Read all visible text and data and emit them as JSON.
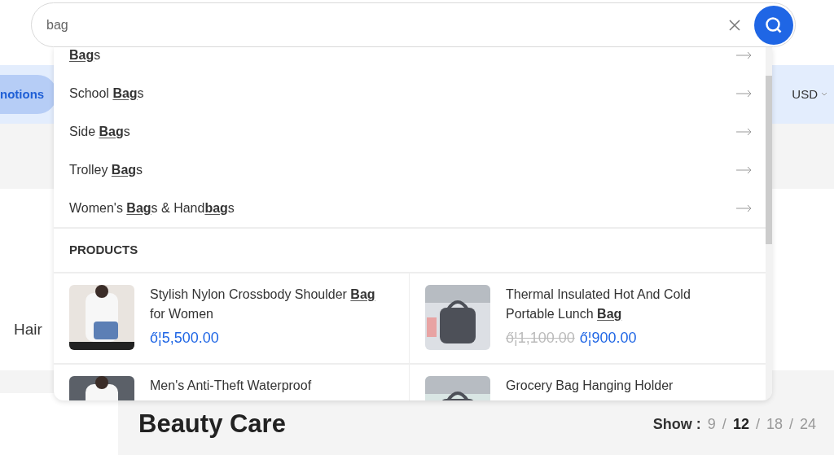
{
  "search": {
    "value": "bag"
  },
  "nav": {
    "pill": "notions",
    "currency": "USD"
  },
  "category_label": "Hair",
  "suggestions": [
    {
      "parts": [
        {
          "text": "Bag",
          "match": true
        },
        {
          "text": "s"
        }
      ]
    },
    {
      "parts": [
        {
          "text": "School "
        },
        {
          "text": "Bag",
          "match": true
        },
        {
          "text": "s"
        }
      ]
    },
    {
      "parts": [
        {
          "text": "Side "
        },
        {
          "text": "Bag",
          "match": true
        },
        {
          "text": "s"
        }
      ]
    },
    {
      "parts": [
        {
          "text": "Trolley "
        },
        {
          "text": "Bag",
          "match": true
        },
        {
          "text": "s"
        }
      ]
    },
    {
      "parts": [
        {
          "text": "Women's "
        },
        {
          "text": "Bag",
          "match": true
        },
        {
          "text": "s & Hand"
        },
        {
          "text": "bag",
          "match": true
        },
        {
          "text": "s"
        }
      ]
    }
  ],
  "products_heading": "PRODUCTS",
  "products": [
    {
      "parts": [
        {
          "text": "Stylish Nylon Crossbody Shoulder "
        },
        {
          "text": "Bag",
          "match": true
        },
        {
          "text": " for Women"
        }
      ],
      "price": "ő¦5,500.00"
    },
    {
      "parts": [
        {
          "text": "Thermal Insulated Hot And Cold Portable Lunch "
        },
        {
          "text": "Bag",
          "match": true
        }
      ],
      "old_price": "ő¦1,100.00",
      "price": "ő¦900.00"
    },
    {
      "parts": [
        {
          "text": "Men's Anti-Theft Waterproof"
        }
      ]
    },
    {
      "parts": [
        {
          "text": "Grocery Bag Hanging Holder"
        }
      ]
    }
  ],
  "section_title": "Beauty Care",
  "show": {
    "label": "Show :",
    "separator": "/",
    "options": [
      {
        "label": "9",
        "selected": false
      },
      {
        "label": "12",
        "selected": true
      },
      {
        "label": "18",
        "selected": false
      },
      {
        "label": "24",
        "selected": false
      }
    ]
  }
}
